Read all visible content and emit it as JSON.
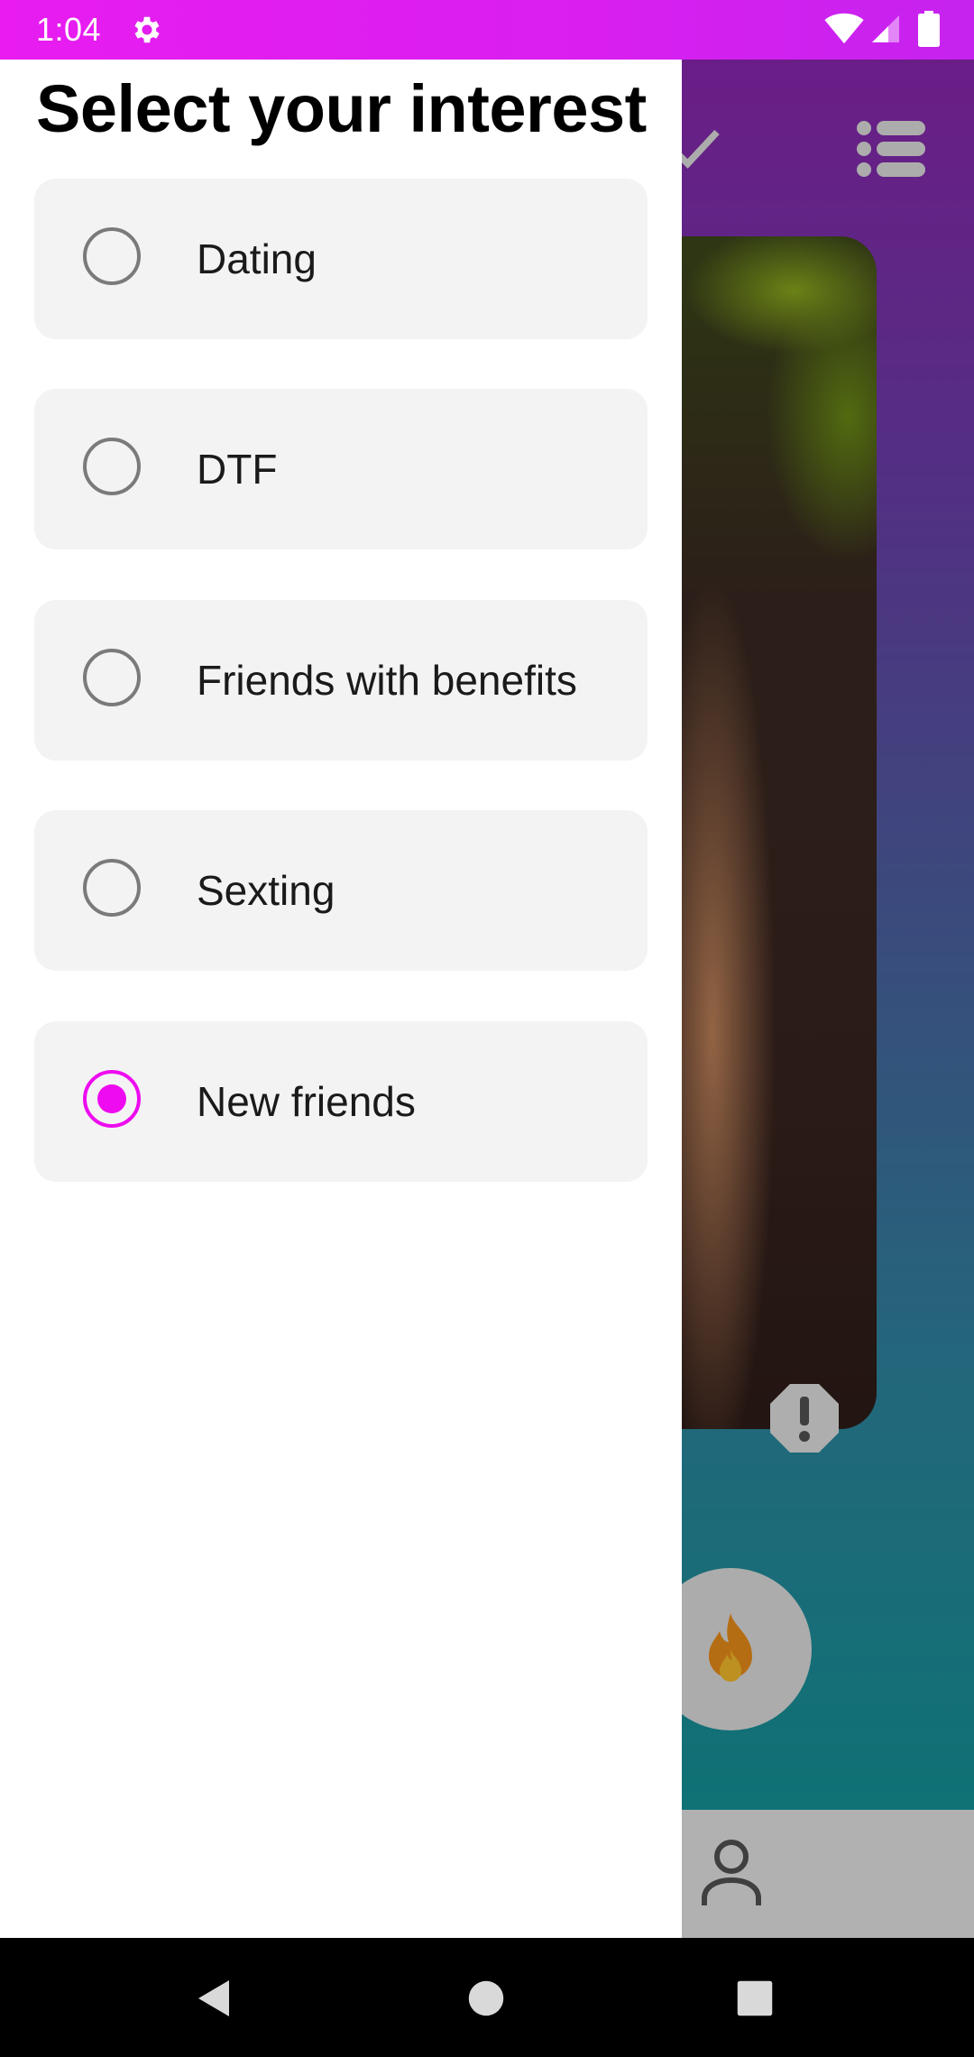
{
  "status_bar": {
    "time": "1:04",
    "icons": [
      "gear-icon",
      "wifi-icon",
      "signal-icon",
      "battery-icon"
    ]
  },
  "drawer": {
    "title": "Select your interest",
    "options": [
      {
        "label": "Dating",
        "selected": false
      },
      {
        "label": "DTF",
        "selected": false
      },
      {
        "label": "Friends with benefits",
        "selected": false
      },
      {
        "label": "Sexting",
        "selected": false
      },
      {
        "label": "New friends",
        "selected": true
      }
    ]
  },
  "background_app": {
    "icons": [
      "check-icon",
      "menu-list-icon",
      "report-icon",
      "fire-icon",
      "profile-icon"
    ]
  },
  "nav_bar": {
    "icons": [
      "back-icon",
      "home-icon",
      "recents-icon"
    ]
  },
  "colors": {
    "accent": "#ee0bf0",
    "status_bar": "#e81cf0",
    "option_background": "#f3f3f3",
    "gradient_top": "#8f27b4",
    "gradient_bottom": "#0c9c9a"
  }
}
